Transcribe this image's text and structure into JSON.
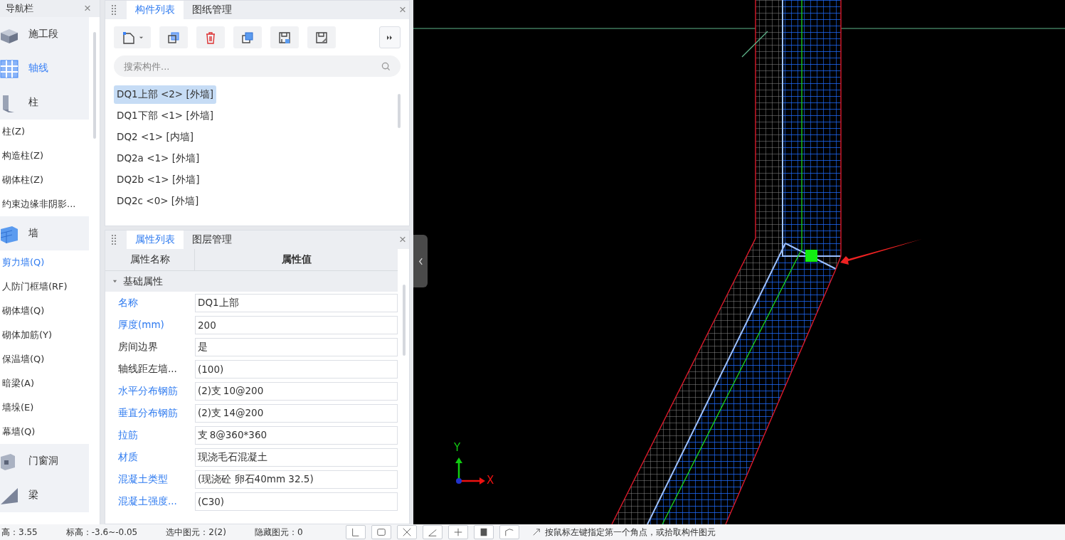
{
  "nav": {
    "title": "导航栏",
    "close": "×",
    "items": [
      {
        "kind": "group",
        "label": "施工段",
        "selected": false
      },
      {
        "kind": "group",
        "label": "轴线",
        "selected": true
      },
      {
        "kind": "group",
        "label": "柱",
        "selected": false
      },
      {
        "kind": "item",
        "label": "柱(Z)",
        "selected": false
      },
      {
        "kind": "item",
        "label": "构造柱(Z)",
        "selected": false
      },
      {
        "kind": "item",
        "label": "砌体柱(Z)",
        "selected": false
      },
      {
        "kind": "item",
        "label": "约束边缘非阴影...",
        "selected": false
      },
      {
        "kind": "group",
        "label": "墙",
        "selected": false
      },
      {
        "kind": "item",
        "label": "剪力墙(Q)",
        "selected": true
      },
      {
        "kind": "item",
        "label": "人防门框墙(RF)",
        "selected": false
      },
      {
        "kind": "item",
        "label": "砌体墙(Q)",
        "selected": false
      },
      {
        "kind": "item",
        "label": "砌体加筋(Y)",
        "selected": false
      },
      {
        "kind": "item",
        "label": "保温墙(Q)",
        "selected": false
      },
      {
        "kind": "item",
        "label": "暗梁(A)",
        "selected": false
      },
      {
        "kind": "item",
        "label": "墙垛(E)",
        "selected": false
      },
      {
        "kind": "item",
        "label": "幕墙(Q)",
        "selected": false
      },
      {
        "kind": "group",
        "label": "门窗洞",
        "selected": false
      },
      {
        "kind": "group",
        "label": "梁",
        "selected": false
      }
    ]
  },
  "components": {
    "tabs": [
      {
        "label": "构件列表",
        "selected": true
      },
      {
        "label": "图纸管理",
        "selected": false
      }
    ],
    "close": "×",
    "search": {
      "placeholder": "搜索构件..."
    },
    "items": [
      {
        "label": "DQ1上部 <2> [外墙]",
        "selected": true
      },
      {
        "label": "DQ1下部 <1> [外墙]",
        "selected": false
      },
      {
        "label": "DQ2 <1> [内墙]",
        "selected": false
      },
      {
        "label": "DQ2a <1> [外墙]",
        "selected": false
      },
      {
        "label": "DQ2b <1> [外墙]",
        "selected": false
      },
      {
        "label": "DQ2c <0> [外墙]",
        "selected": false
      }
    ]
  },
  "properties": {
    "tabs": [
      {
        "label": "属性列表",
        "selected": true
      },
      {
        "label": "图层管理",
        "selected": false
      }
    ],
    "close": "×",
    "columns": [
      "属性名称",
      "属性值"
    ],
    "section": {
      "label": "基础属性",
      "expanded": true
    },
    "rows": [
      {
        "name": "名称",
        "value": "DQ1上部",
        "public": true
      },
      {
        "name": "厚度(mm)",
        "value": "200",
        "public": true
      },
      {
        "name": "房间边界",
        "value": "是",
        "public": false
      },
      {
        "name": "轴线距左墙...",
        "value": "(100)",
        "public": false
      },
      {
        "name": "水平分布钢筋",
        "value": "(2)⽀ 10@200",
        "public": true
      },
      {
        "name": "垂直分布钢筋",
        "value": "(2)⽀ 14@200",
        "public": true
      },
      {
        "name": "拉筋",
        "value": "⽀ 8@360*360",
        "public": true
      },
      {
        "name": "材质",
        "value": "现浇毛石混凝土",
        "public": true
      },
      {
        "name": "混凝土类型",
        "value": "(现浇砼 卵石40mm 32.5)",
        "public": true
      },
      {
        "name": "混凝土强度...",
        "value": "(C30)",
        "public": true
      }
    ]
  },
  "canvas": {
    "axis_y": "Y",
    "axis_x": "X"
  },
  "status_bar": {
    "fields": [
      "高：3.55",
      "标高：-3.6~-0.05",
      "选中图元：2(2)",
      "隐藏图元：0"
    ],
    "hint": "按鼠标左键指定第一个角点，或拾取构件图元"
  }
}
